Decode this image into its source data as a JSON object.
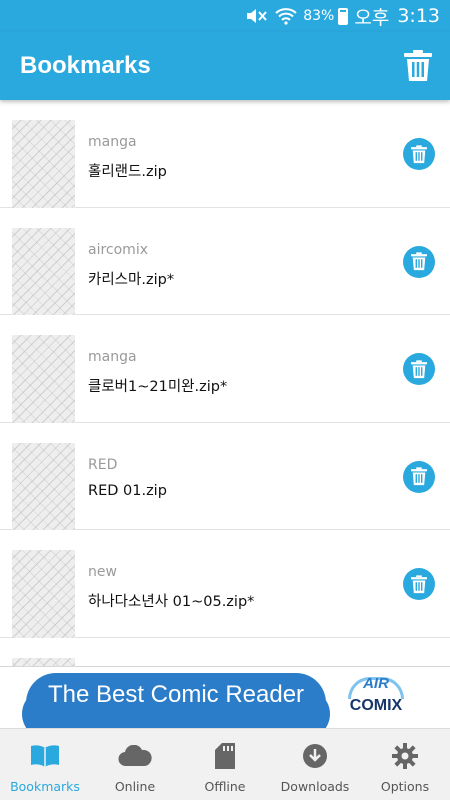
{
  "status_bar": {
    "battery": "83%",
    "ampm": "오후",
    "time": "3:13",
    "icons": [
      "mute-icon",
      "wifi-icon",
      "battery-icon"
    ]
  },
  "app_bar": {
    "title": "Bookmarks",
    "delete_icon": "trash-icon"
  },
  "bookmarks": [
    {
      "folder": "manga",
      "file": "홀리랜드.zip"
    },
    {
      "folder": "aircomix",
      "file": "카리스마.zip*"
    },
    {
      "folder": "manga",
      "file": "클로버1~21미완.zip*"
    },
    {
      "folder": "RED",
      "file": "RED 01.zip"
    },
    {
      "folder": "new",
      "file": "하나다소년사 01~05.zip*"
    },
    {
      "folder": "",
      "file": ""
    }
  ],
  "ad": {
    "headline": "The Best Comic Reader",
    "logo_top": "AIR",
    "logo_bottom": "COMIX"
  },
  "nav": [
    {
      "label": "Bookmarks",
      "icon": "book-icon",
      "active": true
    },
    {
      "label": "Online",
      "icon": "cloud-icon",
      "active": false
    },
    {
      "label": "Offline",
      "icon": "sd-card-icon",
      "active": false
    },
    {
      "label": "Downloads",
      "icon": "download-icon",
      "active": false
    },
    {
      "label": "Options",
      "icon": "gear-icon",
      "active": false
    }
  ],
  "colors": {
    "accent": "#2aa9df",
    "nav_inactive": "#555555",
    "ad_blue": "#2b7cc9",
    "logo_navy": "#16356a"
  }
}
